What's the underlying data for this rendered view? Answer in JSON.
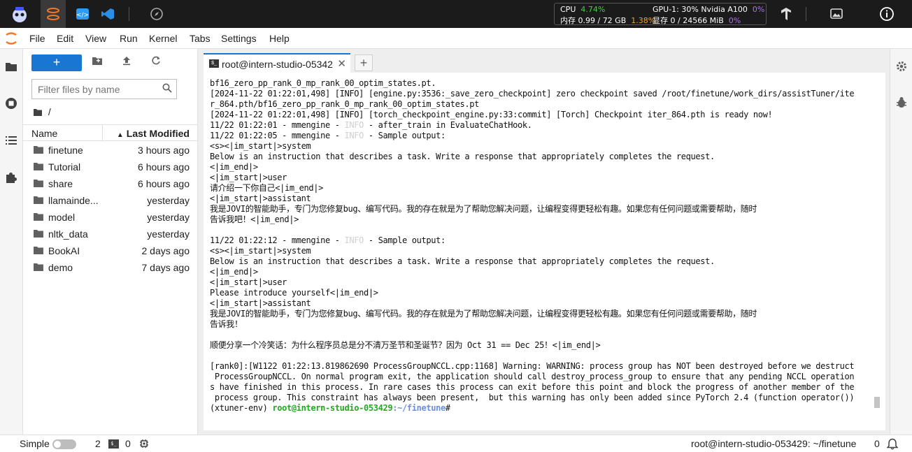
{
  "topbar": {
    "sysmon": {
      "cpu_label": "CPU",
      "cpu_value": "4.74%",
      "mem_label": "内存 0.99 / 72 GB",
      "mem_value": "1.38%",
      "gpu_label": "GPU-1: 30% Nvidia A100",
      "gpu_value": "0%",
      "vram_label": "显存 0 / 24566 MiB",
      "vram_value": "0%"
    }
  },
  "menubar": {
    "items": [
      "File",
      "Edit",
      "View",
      "Run",
      "Kernel",
      "Tabs",
      "Settings",
      "Help"
    ]
  },
  "filebrowser": {
    "new_label": "+",
    "filter_placeholder": "Filter files by name",
    "breadcrumb": "/",
    "col_name": "Name",
    "col_modified": "Last Modified",
    "sort_indicator": "▲",
    "files": [
      {
        "name": "finetune",
        "modified": "3 hours ago"
      },
      {
        "name": "Tutorial",
        "modified": "6 hours ago"
      },
      {
        "name": "share",
        "modified": "6 hours ago"
      },
      {
        "name": "llamainde...",
        "modified": "yesterday"
      },
      {
        "name": "model",
        "modified": "yesterday"
      },
      {
        "name": "nltk_data",
        "modified": "yesterday"
      },
      {
        "name": "BookAI",
        "modified": "2 days ago"
      },
      {
        "name": "demo",
        "modified": "7 days ago"
      }
    ]
  },
  "tabs": [
    {
      "label": "root@intern-studio-05342",
      "icon_text": "$_"
    }
  ],
  "terminal": {
    "lines": [
      {
        "t": "bf16_zero_pp_rank_0_mp_rank_00_optim_states.pt."
      },
      {
        "t": "[2024-11-22 01:22:01,498] [INFO] [engine.py:3536:_save_zero_checkpoint] zero checkpoint saved /root/finetune/work_dirs/assistTuner/ite"
      },
      {
        "t": "r_864.pth/bf16_zero_pp_rank_0_mp_rank_00_optim_states.pt"
      },
      {
        "t": "[2024-11-22 01:22:01,498] [INFO] [torch_checkpoint_engine.py:33:commit] [Torch] Checkpoint iter_864.pth is ready now!"
      },
      {
        "pre": "11/22 01:22:01 - mmengine - ",
        "info": "INFO",
        "post": " - after_train in EvaluateChatHook."
      },
      {
        "pre": "11/22 01:22:05 - mmengine - ",
        "info": "INFO",
        "post": " - Sample output:"
      },
      {
        "t": "<s><|im_start|>system"
      },
      {
        "t": "Below is an instruction that describes a task. Write a response that appropriately completes the request."
      },
      {
        "t": "<|im_end|>"
      },
      {
        "t": "<|im_start|>user"
      },
      {
        "t": "请介绍一下你自己<|im_end|>"
      },
      {
        "t": "<|im_start|>assistant"
      },
      {
        "t": "我是JOVI的智能助手，专门为您修复bug、编写代码。我的存在就是为了帮助您解决问题，让编程变得更轻松有趣。如果您有任何问题或需要帮助，随时"
      },
      {
        "t": "告诉我吧！<|im_end|>"
      },
      {
        "t": ""
      },
      {
        "pre": "11/22 01:22:12 - mmengine - ",
        "info": "INFO",
        "post": " - Sample output:"
      },
      {
        "t": "<s><|im_start|>system"
      },
      {
        "t": "Below is an instruction that describes a task. Write a response that appropriately completes the request."
      },
      {
        "t": "<|im_end|>"
      },
      {
        "t": "<|im_start|>user"
      },
      {
        "t": "Please introduce yourself<|im_end|>"
      },
      {
        "t": "<|im_start|>assistant"
      },
      {
        "t": "我是JOVI的智能助手，专门为您修复bug、编写代码。我的存在就是为了帮助您解决问题，让编程变得更轻松有趣。如果您有任何问题或需要帮助，随时"
      },
      {
        "t": "告诉我！"
      },
      {
        "t": ""
      },
      {
        "t": "顺便分享一个冷笑话：为什么程序员总是分不清万圣节和圣诞节？因为 Oct 31 == Dec 25！<|im_end|>"
      },
      {
        "t": ""
      },
      {
        "t": "[rank0]:[W1122 01:22:13.819862690 ProcessGroupNCCL.cpp:1168] Warning: WARNING: process group has NOT been destroyed before we destruct"
      },
      {
        "t": " ProcessGroupNCCL. On normal program exit, the application should call destroy_process_group to ensure that any pending NCCL operation"
      },
      {
        "t": "s have finished in this process. In rare cases this process can exit before this point and block the progress of another member of the"
      },
      {
        "t": " process group. This constraint has always been present,  but this warning has only been added since PyTorch 2.4 (function operator())"
      }
    ],
    "prompt_env": "(xtuner-env) ",
    "prompt_user": "root@intern-studio-053429",
    "prompt_path": ":~/finetune",
    "prompt_end": "#"
  },
  "statusbar": {
    "mode": "Simple",
    "kernels": "2",
    "terminals": "0",
    "right_text": "root@intern-studio-053429: ~/finetune",
    "notifications": "0"
  }
}
